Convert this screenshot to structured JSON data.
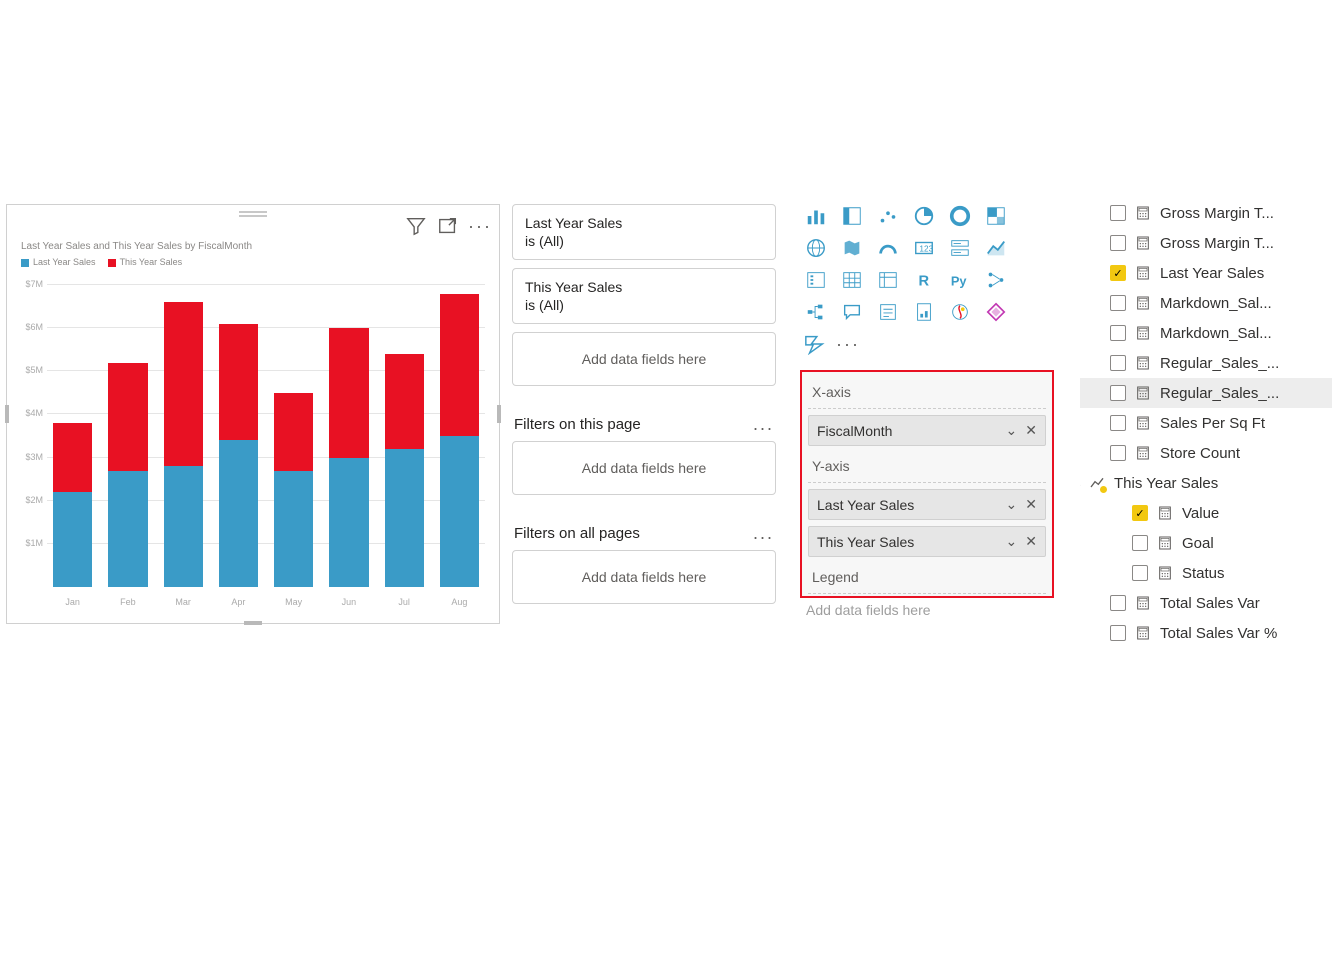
{
  "chart": {
    "title": "Last Year Sales and This Year Sales by FiscalMonth",
    "legend_last": "Last Year Sales",
    "legend_this": "This Year Sales",
    "color_last": "#3a9bc7",
    "color_this": "#e81123",
    "y_ticks": [
      "$1M",
      "$2M",
      "$3M",
      "$4M",
      "$5M",
      "$6M",
      "$7M"
    ]
  },
  "chart_data": {
    "type": "bar",
    "title": "Last Year Sales and This Year Sales by FiscalMonth",
    "xlabel": "",
    "ylabel": "",
    "ylim": [
      0,
      7
    ],
    "categories": [
      "Jan",
      "Feb",
      "Mar",
      "Apr",
      "May",
      "Jun",
      "Jul",
      "Aug"
    ],
    "series": [
      {
        "name": "Last Year Sales",
        "values": [
          2.2,
          2.7,
          2.8,
          3.4,
          2.7,
          3.0,
          3.2,
          3.5
        ]
      },
      {
        "name": "This Year Sales",
        "values": [
          1.6,
          2.5,
          3.8,
          2.7,
          1.8,
          3.0,
          2.2,
          3.3
        ]
      }
    ]
  },
  "filters": {
    "card1_title": "Last Year Sales",
    "card1_sub": "is (All)",
    "card2_title": "This Year Sales",
    "card2_sub": "is (All)",
    "drop_hint": "Add data fields here",
    "section_page": "Filters on this page",
    "section_all": "Filters on all pages"
  },
  "wells": {
    "x_label": "X-axis",
    "x_field": "FiscalMonth",
    "y_label": "Y-axis",
    "y_field1": "Last Year Sales",
    "y_field2": "This Year Sales",
    "legend_label": "Legend",
    "legend_hint": "Add data fields here"
  },
  "fields": {
    "items": [
      {
        "label": "Gross Margin T...",
        "checked": false,
        "icon": "calc"
      },
      {
        "label": "Gross Margin T...",
        "checked": false,
        "icon": "calc"
      },
      {
        "label": "Last Year Sales",
        "checked": true,
        "icon": "calc"
      },
      {
        "label": "Markdown_Sal...",
        "checked": false,
        "icon": "calc"
      },
      {
        "label": "Markdown_Sal...",
        "checked": false,
        "icon": "calc"
      },
      {
        "label": "Regular_Sales_...",
        "checked": false,
        "icon": "calc"
      },
      {
        "label": "Regular_Sales_...",
        "checked": false,
        "icon": "calc",
        "hover": true
      },
      {
        "label": "Sales Per Sq Ft",
        "checked": false,
        "icon": "calc"
      },
      {
        "label": "Store Count",
        "checked": false,
        "icon": "calc"
      }
    ],
    "group_label": "This Year Sales",
    "sub_value": "Value",
    "sub_goal": "Goal",
    "sub_status": "Status",
    "tail": [
      {
        "label": "Total Sales Var",
        "checked": false
      },
      {
        "label": "Total Sales Var %",
        "checked": false
      }
    ]
  }
}
